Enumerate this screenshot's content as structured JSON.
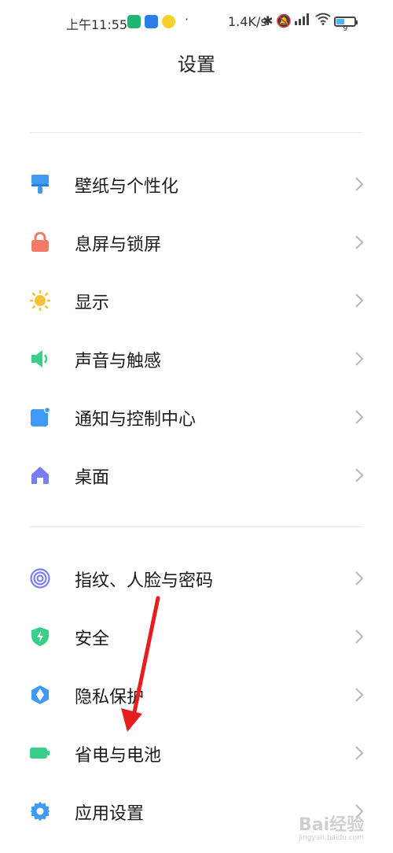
{
  "status_bar": {
    "time": "上午11:55",
    "more_dot": "·",
    "net_speed": "1.4K/s",
    "battery_level": "9"
  },
  "header": {
    "title": "设置"
  },
  "groups": [
    {
      "items": [
        {
          "label": "壁纸与个性化",
          "icon": "wallpaper-brush-icon",
          "color": "#3f9af5"
        },
        {
          "label": "息屏与锁屏",
          "icon": "lock-icon",
          "color": "#f27a68"
        },
        {
          "label": "显示",
          "icon": "sun-icon",
          "color": "#f7c23a"
        },
        {
          "label": "声音与触感",
          "icon": "speaker-icon",
          "color": "#37cf8a"
        },
        {
          "label": "通知与控制中心",
          "icon": "notification-icon",
          "color": "#3f9af5"
        },
        {
          "label": "桌面",
          "icon": "home-icon",
          "color": "#7a7ef2"
        }
      ]
    },
    {
      "items": [
        {
          "label": "指纹、人脸与密码",
          "icon": "fingerprint-icon",
          "color": "#7a7ef2"
        },
        {
          "label": "安全",
          "icon": "shield-icon",
          "color": "#37cf8a"
        },
        {
          "label": "隐私保护",
          "icon": "privacy-icon",
          "color": "#3f9af5"
        },
        {
          "label": "省电与电池",
          "icon": "battery-icon",
          "color": "#37cf8a"
        },
        {
          "label": "应用设置",
          "icon": "gear-icon",
          "color": "#3f9af5"
        }
      ]
    }
  ],
  "watermark": {
    "text": "Bai经验",
    "url_text": "jingyan.baidu.com"
  }
}
